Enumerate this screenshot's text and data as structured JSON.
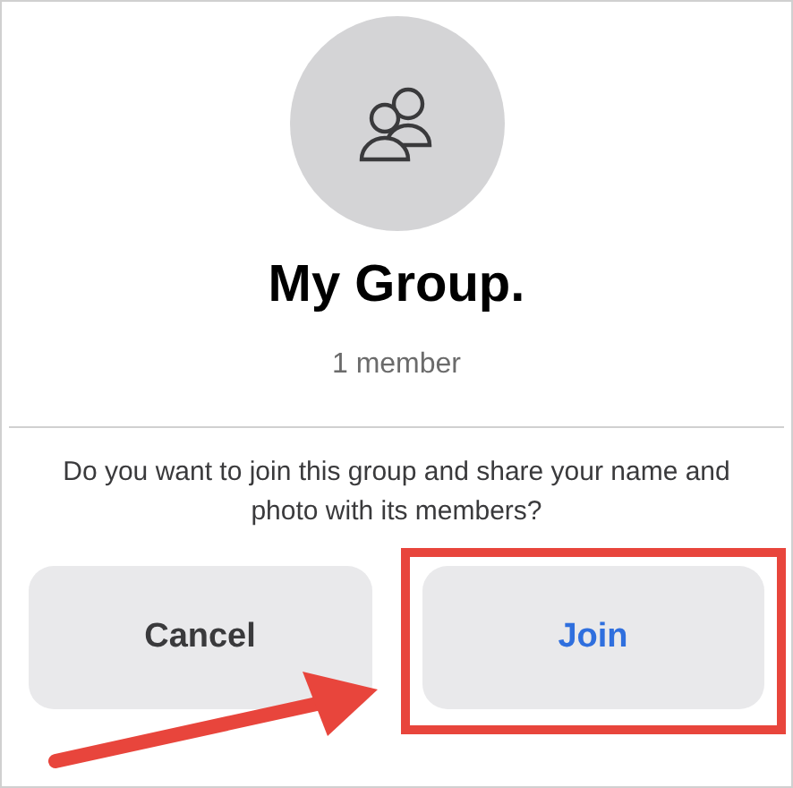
{
  "group": {
    "name": "My Group.",
    "member_count": "1 member"
  },
  "prompt": "Do you want to join this group and share your name and photo with its members?",
  "buttons": [
    {
      "label": "Cancel",
      "kind": "cancel",
      "highlighted": false
    },
    {
      "label": "Join",
      "kind": "confirm",
      "highlighted": true
    }
  ]
}
